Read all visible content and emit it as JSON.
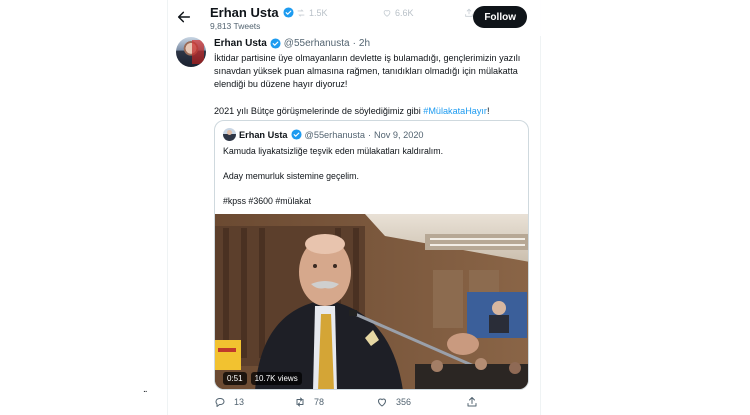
{
  "header": {
    "name": "Erhan Usta",
    "tweet_count": "9,813 Tweets",
    "follow_label": "Follow",
    "faint_stats": [
      "1.5K",
      "6.6K"
    ]
  },
  "tweet": {
    "name": "Erhan Usta",
    "handle": "@55erhanusta",
    "separator": "·",
    "time": "2h",
    "line1": "İktidar partisine üye olmayanların devlette iş bulamadığı, gençlerimizin yazılı sınavdan yüksek puan almasına rağmen, tanıdıkları olmadığı için mülakatta elendiği bu düzene hayır diyoruz!",
    "line2_text": "2021 yılı Bütçe görüşmelerinde de söylediğimiz gibi ",
    "line2_hashtag": "#MülakataHayır",
    "line2_end": "!"
  },
  "quote": {
    "name": "Erhan Usta",
    "handle": "@55erhanusta",
    "separator": "·",
    "date": "Nov 9, 2020",
    "p1": "Kamuda liyakatsizliğe teşvik eden mülakatları kaldıralım.",
    "p2": "Aday memurluk sistemine geçelim.",
    "p3": "#kpss #3600 #mülakat",
    "video_time": "0:51",
    "video_views": "10.7K views"
  },
  "actions": {
    "replies": "13",
    "retweets": "78",
    "likes": "356"
  },
  "stray_text": "..",
  "colors": {
    "accent": "#1d9bf0",
    "text": "#0f1419",
    "secondary": "#536471",
    "border": "#cfd9de"
  },
  "icons": [
    "back-arrow-icon",
    "verified-badge-icon",
    "reply-icon",
    "retweet-icon",
    "like-icon",
    "share-icon"
  ]
}
